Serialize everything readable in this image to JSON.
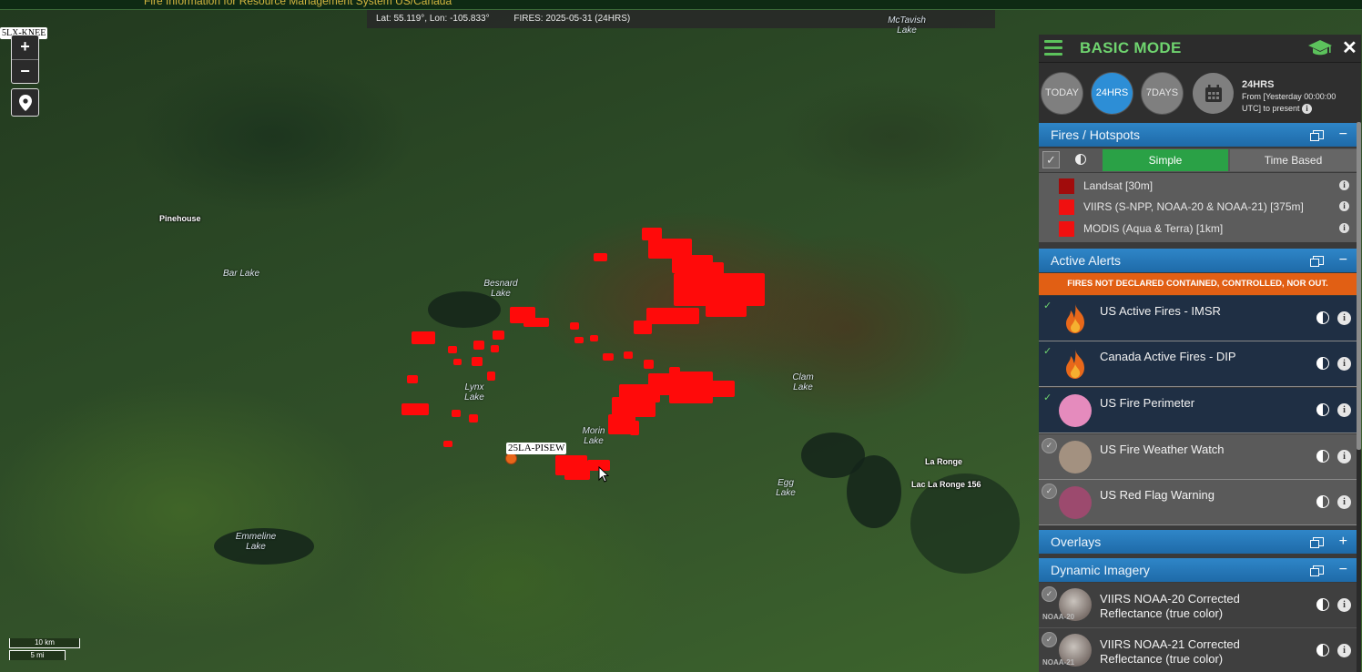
{
  "app": {
    "header_text": "Fire Information for Resource Management System US/Canada"
  },
  "coords": {
    "latlon": "Lat: 55.119°, Lon: -105.833°",
    "fires": "FIRES: 2025-05-31 (24HRS)"
  },
  "map": {
    "zoom_in": "+",
    "zoom_out": "−",
    "top_left_tag": "5LX-KNEE",
    "fire_tag": "25LA-PISEW",
    "labels": {
      "pinehouse": "Pinehouse",
      "bar_lake": "Bar Lake",
      "besnard_lake": "Besnard Lake",
      "lynx_lake": "Lynx Lake",
      "morin_lake": "Morin Lake",
      "clam_lake": "Clam Lake",
      "egg_lake": "Egg Lake",
      "emmeline_lake": "Emmeline Lake",
      "la_ronge": "La Ronge",
      "lac_la_ronge": "Lac La Ronge 156",
      "mctavish_lake": "McTavish Lake"
    },
    "scale": {
      "km": "10 km",
      "mi": "5 mi"
    }
  },
  "panel": {
    "mode_title": "BASIC MODE",
    "close": "✕",
    "time": {
      "today": "TODAY",
      "h24": "24HRS",
      "d7": "7DAYS",
      "info_title": "24HRS",
      "info_text": "From [Yesterday 00:00:00 UTC] to present",
      "selected": "24HRS"
    },
    "fires_section": {
      "title": "Fires / Hotspots",
      "simple": "Simple",
      "time_based": "Time Based",
      "legend": [
        {
          "label": "Landsat [30m]",
          "color": "#a10c0c"
        },
        {
          "label": "VIIRS (S-NPP, NOAA-20 & NOAA-21) [375m]",
          "color": "#f01010"
        },
        {
          "label": "MODIS (Aqua & Terra) [1km]",
          "color": "#f01010"
        }
      ]
    },
    "alerts_section": {
      "title": "Active Alerts",
      "banner": "FIRES NOT DECLARED CONTAINED, CONTROLLED, NOR OUT.",
      "items": [
        {
          "label": "US Active Fires - IMSR",
          "enabled": true,
          "icon": "flame-icon"
        },
        {
          "label": "Canada Active Fires - DIP",
          "enabled": true,
          "icon": "flame-icon"
        },
        {
          "label": "US Fire Perimeter",
          "enabled": true,
          "color": "#e58bbd"
        },
        {
          "label": "US Fire Weather Watch",
          "enabled": false,
          "color": "#a39180"
        },
        {
          "label": "US Red Flag Warning",
          "enabled": false,
          "color": "#9c4a6e"
        }
      ]
    },
    "overlays_section": {
      "title": "Overlays"
    },
    "imagery_section": {
      "title": "Dynamic Imagery",
      "items": [
        {
          "label": "VIIRS NOAA-20 Corrected Reflectance (true color)",
          "tag": "NOAA-20"
        },
        {
          "label": "VIIRS NOAA-21 Corrected Reflectance (true color)",
          "tag": "NOAA-21"
        }
      ]
    }
  },
  "colors": {
    "accent_green": "#6fd46f",
    "section_blue": "#1e6aa8",
    "alert_orange": "#e15f14",
    "fire_red": "#ff0a0a",
    "active_blue": "#2d8ed6"
  }
}
